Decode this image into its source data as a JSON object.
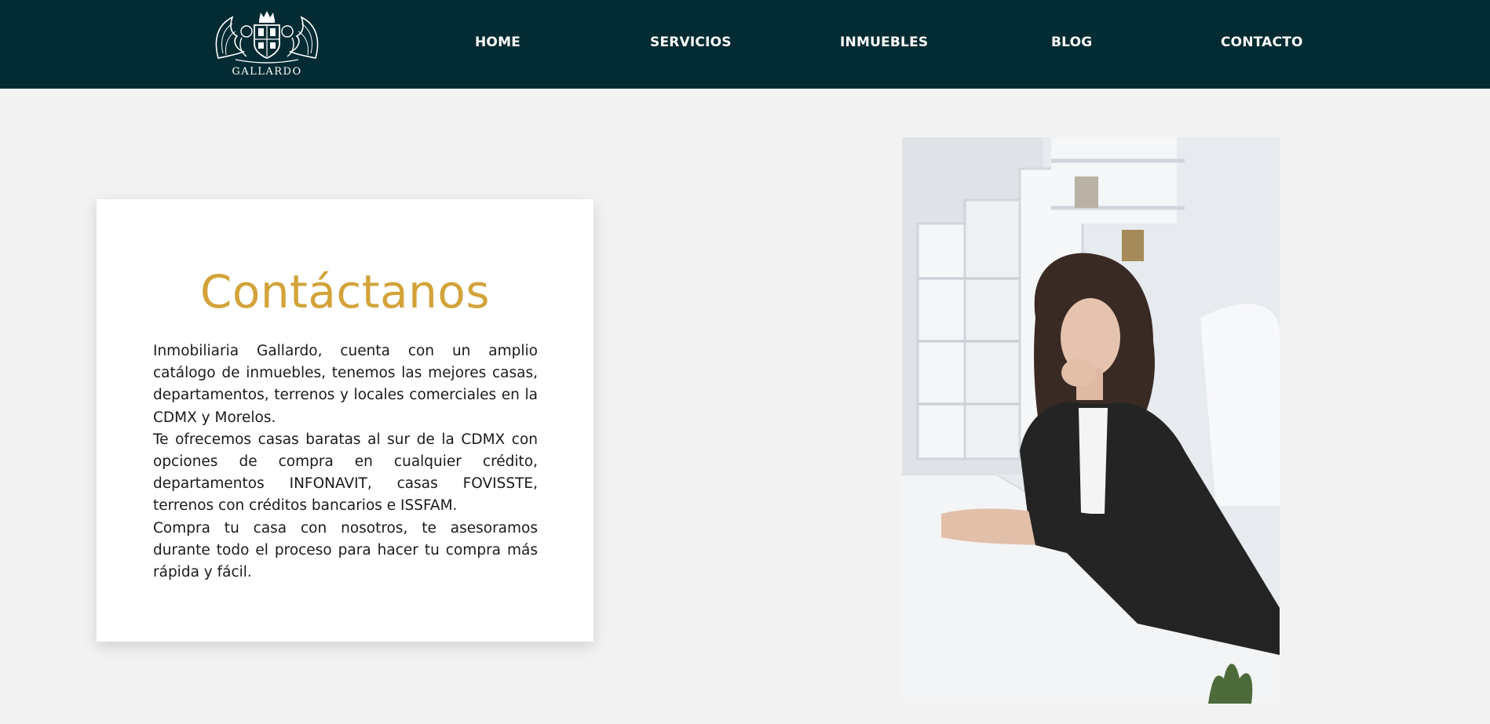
{
  "header": {
    "logo": {
      "icon": "coat-of-arms-icon",
      "text": "GALLARDO"
    },
    "nav": [
      {
        "label": "HOME"
      },
      {
        "label": "SERVICIOS"
      },
      {
        "label": "INMUEBLES"
      },
      {
        "label": "BLOG"
      },
      {
        "label": "CONTACTO"
      }
    ]
  },
  "contact": {
    "title": "Contáctanos",
    "paragraphs": [
      "Inmobiliaria Gallardo, cuenta con un amplio catálogo de inmuebles, tenemos las mejores casas, departamentos, terrenos y locales comerciales en la CDMX y Morelos.",
      "Te ofrecemos casas baratas al sur de la CDMX con opciones de compra en cualquier crédito, departamentos INFONAVIT, casas FOVISSTE, terrenos con créditos bancarios e ISSFAM.",
      "Compra tu casa con nosotros, te asesoramos durante todo el proceso para hacer tu compra más rápida y fácil."
    ]
  },
  "colors": {
    "header_bg": "#032b33",
    "page_bg": "#f2f2f2",
    "accent": "#d3a33a",
    "text": "#1a1a1a"
  }
}
